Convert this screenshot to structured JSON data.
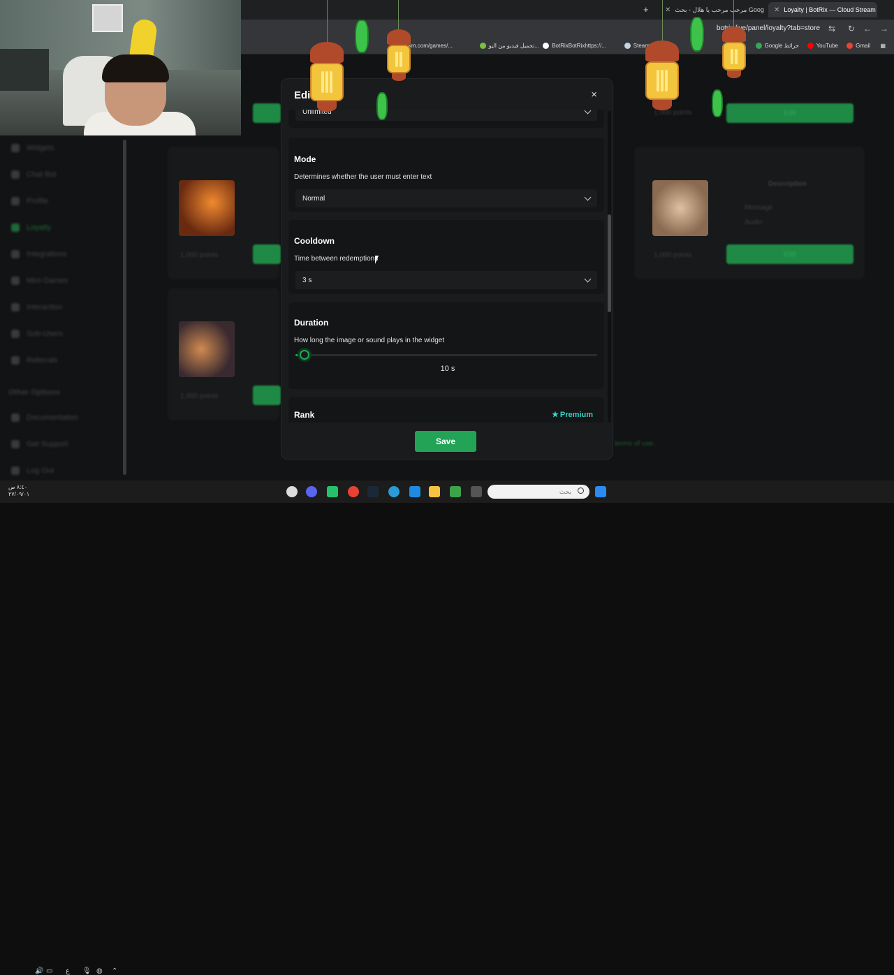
{
  "browser": {
    "tabs": [
      {
        "label": "Loyalty | BotRix — Cloud Stream",
        "active": true
      },
      {
        "label": "مرحب مرحب يا هلال - بحث Google",
        "active": false
      }
    ],
    "new_tab": "+",
    "url": "botrix.live/panel/loyalty?tab=store",
    "bookmarks": [
      {
        "label": "Gmail",
        "color": "#ea4335"
      },
      {
        "label": "YouTube",
        "color": "#ff0000"
      },
      {
        "label": "Google خرائط",
        "color": "#34a853"
      },
      {
        "label": "Steam Workshop",
        "color": "#1b2838"
      },
      {
        "label": "BotRixBotRixhttps://...",
        "color": "#ffffff"
      },
      {
        "label": "تحميل فيديو من اليو...",
        "color": "#7cc142"
      },
      {
        "label": "km.com/games/...",
        "color": "#ffffff"
      }
    ]
  },
  "sidebar": {
    "items": [
      {
        "label": "Widgets"
      },
      {
        "label": "Chat Bot"
      },
      {
        "label": "Profile"
      },
      {
        "label": "Loyalty"
      },
      {
        "label": "Integrations"
      },
      {
        "label": "Mini-Games"
      },
      {
        "label": "Interaction"
      },
      {
        "label": "Sub-Users"
      },
      {
        "label": "Referrals"
      }
    ],
    "other_heading": "Other Options",
    "other_items": [
      {
        "label": "Documentation"
      },
      {
        "label": "Get Support"
      },
      {
        "label": "Log Out"
      }
    ]
  },
  "background": {
    "points_label": "1,000 points",
    "edit_label": "Edit",
    "description": "Description",
    "message": "Message",
    "audio": "Audio",
    "terms": "terms of use."
  },
  "modal": {
    "title": "Edit",
    "close": "×",
    "limit_value": "Unlimited",
    "mode": {
      "title": "Mode",
      "description": "Determines whether the user must enter text",
      "value": "Normal"
    },
    "cooldown": {
      "title": "Cooldown",
      "description": "Time between redemptions",
      "value": "3 s"
    },
    "duration": {
      "title": "Duration",
      "description": "How long the image or sound plays in the widget",
      "value": "10 s",
      "fraction": 0.03
    },
    "rank": {
      "title": "Rank",
      "badge": "Premium"
    },
    "save_label": "Save"
  },
  "taskbar": {
    "search_placeholder": "بحث",
    "clock_time": "٨:٤٠ ص",
    "clock_date": "٢٧/٠٩/٠١"
  },
  "colors": {
    "accent_green": "#22a356",
    "premium": "#2fd8c9"
  }
}
